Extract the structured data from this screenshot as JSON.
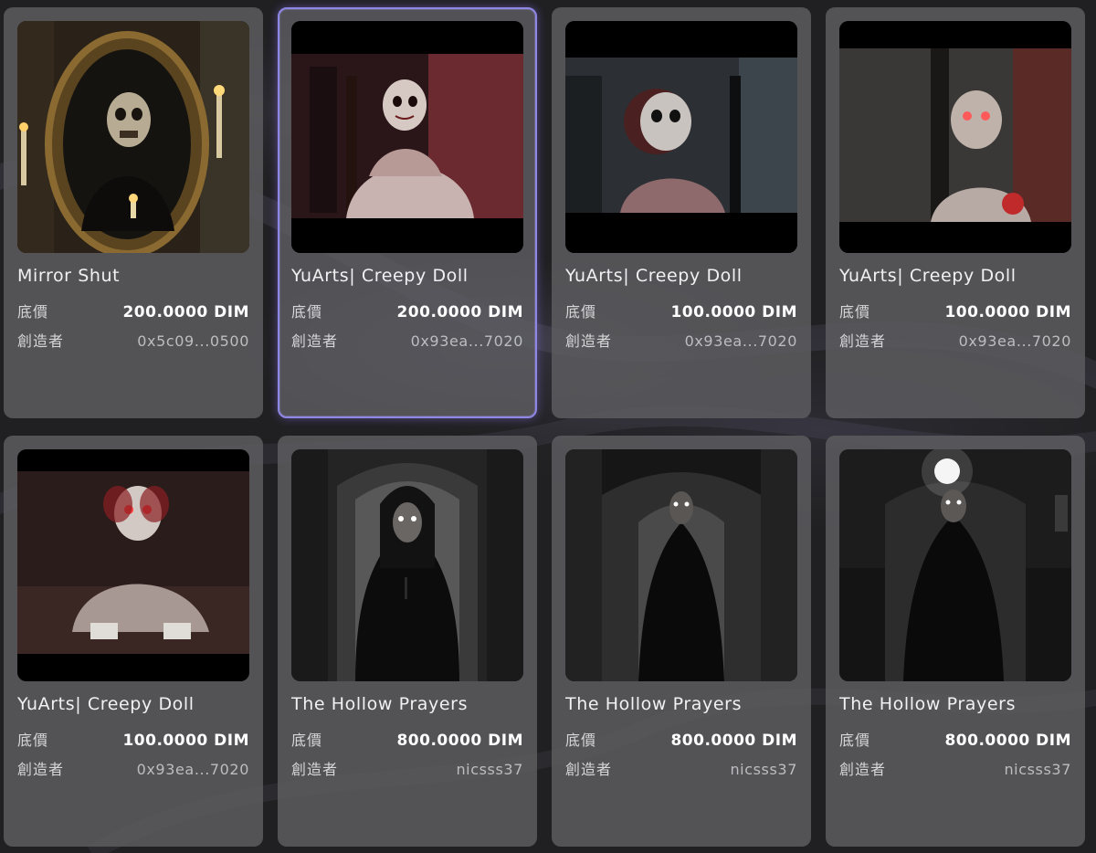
{
  "labels": {
    "floor_price": "底價",
    "creator": "創造者"
  },
  "cards": [
    {
      "title": "Mirror Shut",
      "price": "200.0000 DIM",
      "creator": "0x5c09...0500",
      "image": "mirror-ghoul-image",
      "selected": false
    },
    {
      "title": "YuArts| Creepy Doll",
      "price": "200.0000 DIM",
      "creator": "0x93ea...7020",
      "image": "creepy-doll-red-image",
      "selected": true
    },
    {
      "title": "YuArts| Creepy Doll",
      "price": "100.0000 DIM",
      "creator": "0x93ea...7020",
      "image": "creepy-doll-blue-image",
      "selected": false
    },
    {
      "title": "YuArts| Creepy Doll",
      "price": "100.0000 DIM",
      "creator": "0x93ea...7020",
      "image": "creepy-doll-wall-image",
      "selected": false
    },
    {
      "title": "YuArts| Creepy Doll",
      "price": "100.0000 DIM",
      "creator": "0x93ea...7020",
      "image": "creepy-doll-floor-image",
      "selected": false
    },
    {
      "title": "The Hollow Prayers",
      "price": "800.0000 DIM",
      "creator": "nicsss37",
      "image": "hollow-nun-doorway-image",
      "selected": false
    },
    {
      "title": "The Hollow Prayers",
      "price": "800.0000 DIM",
      "creator": "nicsss37",
      "image": "hollow-nun-hallway-image",
      "selected": false
    },
    {
      "title": "The Hollow Prayers",
      "price": "800.0000 DIM",
      "creator": "nicsss37",
      "image": "hollow-nun-lamp-image",
      "selected": false
    }
  ],
  "colors": {
    "card_bg": "#5c5c5f",
    "selected_border": "#8f87e6",
    "page_bg": "#202022"
  }
}
